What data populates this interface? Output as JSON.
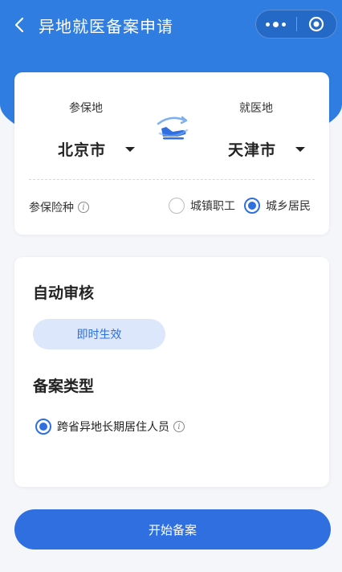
{
  "nav": {
    "title": "异地就医备案申请",
    "icons": [
      "back-icon",
      "more-icon",
      "target-icon"
    ]
  },
  "location": {
    "insured_label": "参保地",
    "insured_city": "北京市",
    "medical_label": "就医地",
    "medical_city": "天津市",
    "swap_icon": "swap-plane-icon"
  },
  "insurance": {
    "label": "参保险种",
    "options": [
      {
        "label": "城镇职工",
        "selected": false
      },
      {
        "label": "城乡居民",
        "selected": true
      }
    ]
  },
  "auto_review": {
    "title": "自动审核",
    "badge": "即时生效"
  },
  "filing_type": {
    "title": "备案类型",
    "option": "跨省异地长期居住人员",
    "selected": true
  },
  "actions": {
    "start": "开始备案"
  },
  "colors": {
    "primary": "#2f6fe0",
    "header": "#2f7de0",
    "badge_bg": "#dce7fb"
  }
}
